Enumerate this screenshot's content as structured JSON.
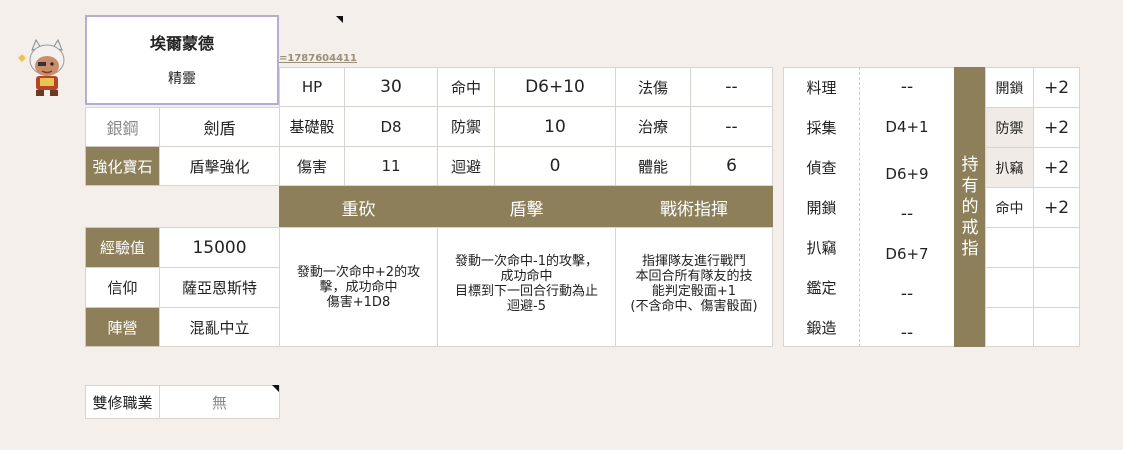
{
  "character": {
    "name": "埃爾蒙德",
    "race": "精靈",
    "link_text": "=1787604411"
  },
  "equipment": {
    "weapon_label": "銀鋼",
    "weapon_value": "劍盾",
    "gem_label": "強化寶石",
    "gem_value": "盾擊強化"
  },
  "stats": [
    {
      "label": "HP",
      "value": "30"
    },
    {
      "label": "命中",
      "value": "D6+10"
    },
    {
      "label": "法傷",
      "value": "--"
    },
    {
      "label": "基礎骰",
      "value": "D8"
    },
    {
      "label": "防禦",
      "value": "10"
    },
    {
      "label": "治療",
      "value": "--"
    },
    {
      "label": "傷害",
      "value": "11"
    },
    {
      "label": "迴避",
      "value": "0"
    },
    {
      "label": "體能",
      "value": "6"
    }
  ],
  "skills": [
    {
      "name": "重砍",
      "lines": [
        "發動一次命中+2的攻",
        "擊，成功命中",
        "傷害+1D8"
      ]
    },
    {
      "name": "盾擊",
      "lines": [
        "發動一次命中-1的攻擊，",
        "成功命中",
        "目標到下一回合行動為止",
        "迴避-5"
      ]
    },
    {
      "name": "戰術指揮",
      "lines": [
        "指揮隊友進行戰鬥",
        "本回合所有隊友的技",
        "能判定骰面+1",
        "(不含命中、傷害骰面)"
      ]
    }
  ],
  "profile": {
    "exp_label": "經驗值",
    "exp_value": "15000",
    "faith_label": "信仰",
    "faith_value": "薩亞恩斯特",
    "camp_label": "陣營",
    "camp_value": "混亂中立"
  },
  "dual_class": {
    "label": "雙修職業",
    "value": "無"
  },
  "life_skills": [
    {
      "label": "料理",
      "value": "--"
    },
    {
      "label": "採集",
      "value": "D4+1"
    },
    {
      "label": "偵查",
      "value": "D6+9"
    },
    {
      "label": "開鎖",
      "value": "--"
    },
    {
      "label": "扒竊",
      "value": "D6+7"
    },
    {
      "label": "鑑定",
      "value": "--"
    },
    {
      "label": "鍛造",
      "value": "--"
    }
  ],
  "rings": {
    "title_chars": [
      "持",
      "有",
      "的",
      "戒",
      "指"
    ],
    "items": [
      {
        "label": "開鎖",
        "value": "+2"
      },
      {
        "label": "防禦",
        "value": "+2"
      },
      {
        "label": "扒竊",
        "value": "+2"
      },
      {
        "label": "命中",
        "value": "+2"
      }
    ]
  }
}
